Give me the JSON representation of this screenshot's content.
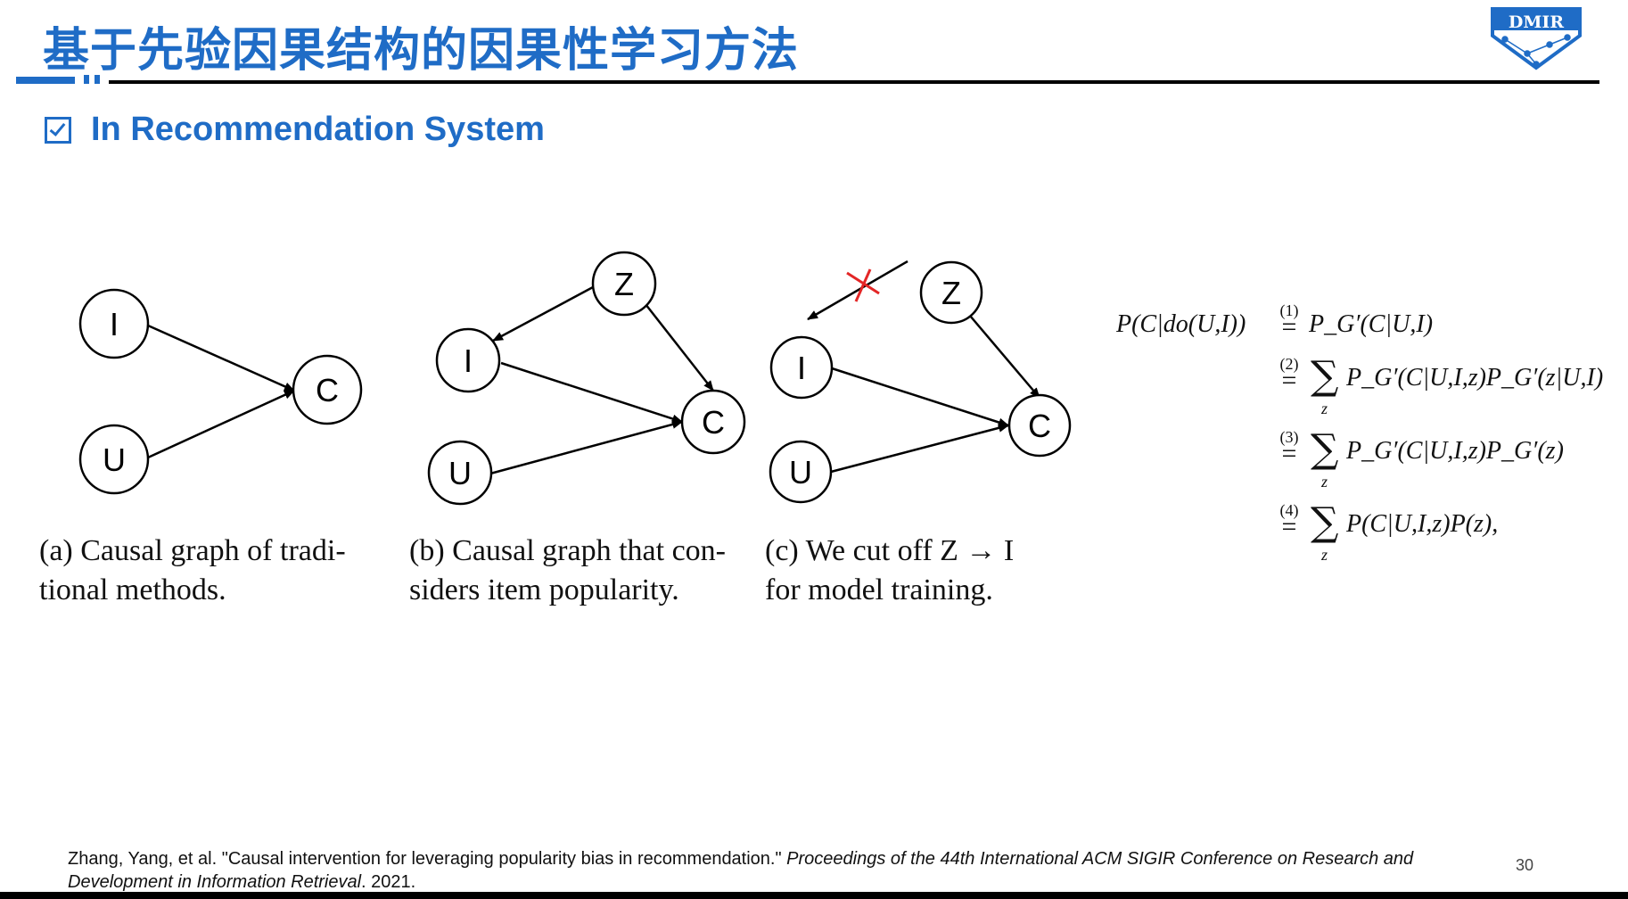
{
  "header": {
    "title": "基于先验因果结构的因果性学习方法",
    "logo_text": "DMIR"
  },
  "section": {
    "title": "In Recommendation System"
  },
  "diagrams": {
    "nodes": {
      "I": "I",
      "U": "U",
      "C": "C",
      "Z": "Z"
    }
  },
  "captions": {
    "a": [
      "(a)  Causal graph  of  tradi-",
      "tional methods."
    ],
    "b": [
      "(b)  Causal graph that con-",
      "siders item popularity."
    ],
    "c": [
      "(c)  We cut off Z  →  I",
      "for model training."
    ]
  },
  "equations": {
    "lhs": "P(C|do(U,I))",
    "numbers": [
      "(1)",
      "(2)",
      "(3)",
      "(4)"
    ],
    "lines": [
      "P_G′(C|U,I)",
      "P_G′(C|U,I,z)P_G′(z|U,I)",
      "P_G′(C|U,I,z)P_G′(z)",
      "P(C|U,I,z)P(z),"
    ],
    "sum_index": "z"
  },
  "reference": {
    "plain": "Zhang, Yang, et al. \"Causal intervention for leveraging popularity bias in recommendation.\" ",
    "venue": "Proceedings of the 44th International ACM SIGIR Conference on Research and Development in Information Retrieval",
    "year": ". 2021."
  },
  "page_number": "30",
  "colors": {
    "accent": "#1f6cc6",
    "cut_mark": "#e32626"
  }
}
